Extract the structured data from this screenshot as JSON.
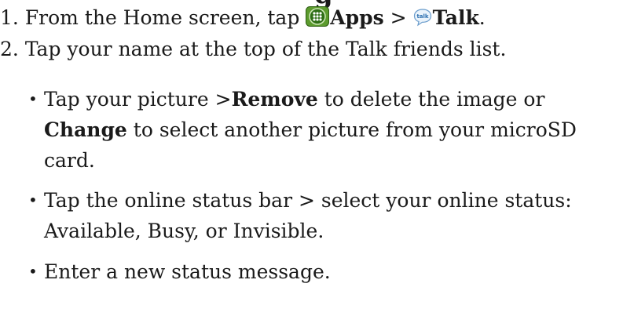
{
  "heading_fragment": "g",
  "steps": [
    {
      "num": "1.",
      "pre": "From the Home screen, tap ",
      "apps_label": "Apps",
      "separator": " > ",
      "talk_label": "Talk",
      "end": "."
    },
    {
      "num": "2.",
      "text": "Tap your name at the top of the Talk friends list."
    }
  ],
  "bullets": [
    {
      "pre": "Tap your picture >",
      "bold1": "Remove",
      "mid": " to delete the image or ",
      "bold2": "Change",
      "post": " to select another picture from your microSD card."
    },
    {
      "text": "Tap the online status bar > select your online status: Available, Busy, or Invisible."
    },
    {
      "text": "Enter a new status message."
    }
  ],
  "icons": {
    "apps": "apps-grid-icon",
    "talk": "talk-bubble-icon",
    "apps_color": "#3f8a1e",
    "talk_text": "talk"
  }
}
